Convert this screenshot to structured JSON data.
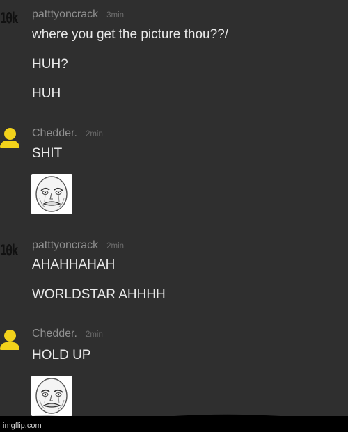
{
  "messages": [
    {
      "avatar": "10k",
      "username": "patttyoncrack",
      "time": "3min",
      "lines": [
        "where you get the picture thou??/",
        "HUH?",
        "HUH"
      ]
    },
    {
      "avatar": "person-icon",
      "username": "Chedder.",
      "time": "2min",
      "lines": [
        "SHIT"
      ],
      "image": "crying-meme-face"
    },
    {
      "avatar": "10k",
      "username": "patttyoncrack",
      "time": "2min",
      "lines": [
        "AHAHHAHAH",
        "WORLDSTAR AHHHH"
      ]
    },
    {
      "avatar": "person-icon",
      "username": "Chedder.",
      "time": "2min",
      "lines": [
        "HOLD UP"
      ],
      "image": "crying-meme-face"
    }
  ],
  "watermark": "imgflip.com",
  "colors": {
    "background": "#2f2f2f",
    "avatar_yellow": "#f2d21b",
    "username": "#8f8f8f",
    "message_text": "#e9e9e9"
  }
}
